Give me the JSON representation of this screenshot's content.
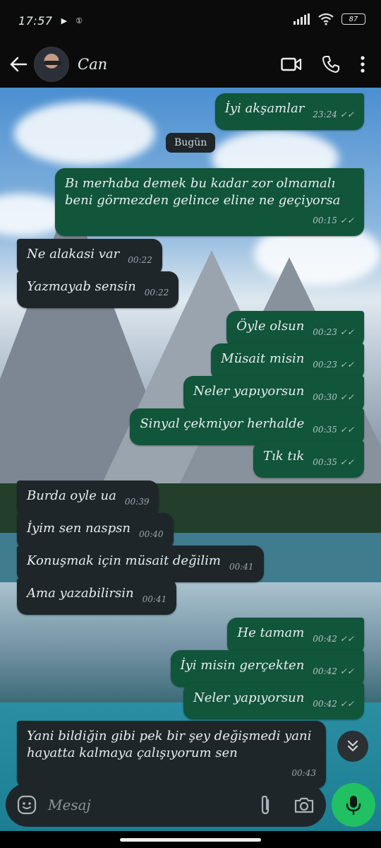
{
  "status_bar": {
    "time": "17:57",
    "battery": "87"
  },
  "header": {
    "contact_name": "Can"
  },
  "chat": {
    "date_divider": "Bugün",
    "messages": [
      {
        "dir": "out",
        "text": "İyi akşamlar",
        "time": "23:24"
      },
      {
        "dir": "out",
        "text": "Bı merhaba demek bu kadar zor olmamalı beni görmezden gelince eline ne geçiyorsa",
        "time": "00:15"
      },
      {
        "dir": "in",
        "text": "Ne alakasi var",
        "time": "00:22"
      },
      {
        "dir": "in",
        "text": "Yazmayab sensin",
        "time": "00:22"
      },
      {
        "dir": "out",
        "text": "Öyle olsun",
        "time": "00:23"
      },
      {
        "dir": "out",
        "text": "Müsait misin",
        "time": "00:23"
      },
      {
        "dir": "out",
        "text": "Neler yapıyorsun",
        "time": "00:30"
      },
      {
        "dir": "out",
        "text": "Sinyal çekmiyor herhalde",
        "time": "00:35"
      },
      {
        "dir": "out",
        "text": "Tık tık",
        "time": "00:35"
      },
      {
        "dir": "in",
        "text": "Burda oyle ua",
        "time": "00:39"
      },
      {
        "dir": "in",
        "text": "İyim sen naspsn",
        "time": "00:40"
      },
      {
        "dir": "in",
        "text": "Konuşmak için müsait değilim",
        "time": "00:41"
      },
      {
        "dir": "in",
        "text": "Ama yazabilirsin",
        "time": "00:41"
      },
      {
        "dir": "out",
        "text": "He tamam",
        "time": "00:42"
      },
      {
        "dir": "out",
        "text": "İyi misin gerçekten",
        "time": "00:42"
      },
      {
        "dir": "out",
        "text": "Neler yapıyorsun",
        "time": "00:42"
      },
      {
        "dir": "in",
        "text": "Yani bildiğin gibi pek bir şey değişmedi yani hayatta kalmaya çalışıyorum sen",
        "time": "00:43"
      }
    ]
  },
  "composer": {
    "placeholder": "Mesaj"
  },
  "icons": {
    "back": "arrow-left-icon",
    "video": "video-call-icon",
    "call": "phone-icon",
    "menu": "more-vert-icon",
    "emoji": "sticker-icon",
    "attach": "paperclip-icon",
    "camera": "camera-icon",
    "mic": "microphone-icon",
    "scroll": "double-chevron-down-icon",
    "read": "double-check-icon"
  },
  "colors": {
    "outgoing_bubble": "#11553a",
    "incoming_bubble": "#1f262a",
    "mic_button": "#21c063"
  }
}
